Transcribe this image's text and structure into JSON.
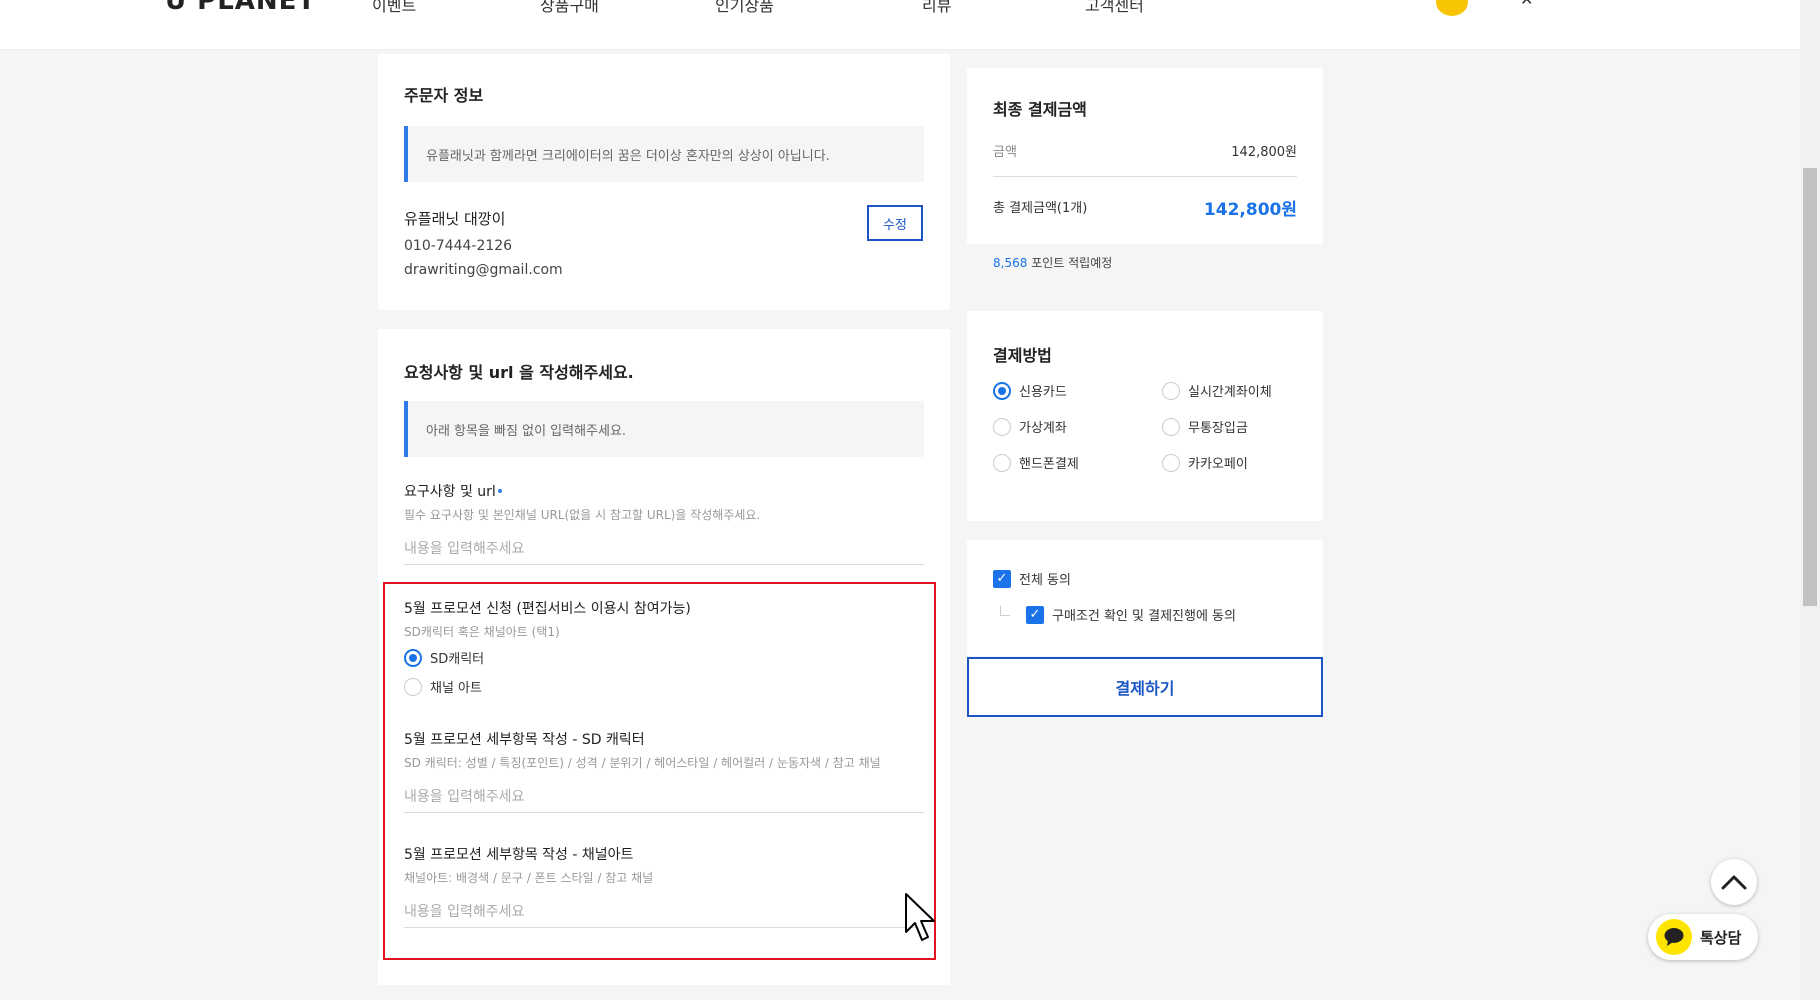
{
  "header": {
    "logo": "U PLANET",
    "nav": [
      "이벤트",
      "상품구매",
      "인기상품",
      "리뷰",
      "고객센터"
    ]
  },
  "orderer": {
    "title": "주문자 정보",
    "notice": "유플래닛과 함께라면 크리에이터의 꿈은 더이상 혼자만의 상상이 아닙니다.",
    "name": "유플래닛 대깡이",
    "phone": "010-7444-2126",
    "email": "drawriting@gmail.com",
    "edit_label": "수정"
  },
  "request": {
    "title": "요청사항 및 url 을 작성해주세요.",
    "notice": "아래 항목을 빠짐 없이 입력해주세요.",
    "field1": {
      "label": "요구사항 및 url",
      "required_mark": "•",
      "help": "필수 요구사항 및 본인채널 URL(없을 시 참고할 URL)을 작성해주세요.",
      "placeholder": "내용을 입력해주세요"
    },
    "promo": {
      "label": "5월 프로모션 신청 (편집서비스 이용시 참여가능)",
      "help": "SD캐릭터 혹은 채널아트 (택1)",
      "options": [
        "SD캐릭터",
        "채널 아트"
      ],
      "selected": "SD캐릭터"
    },
    "field2": {
      "label": "5월 프로모션 세부항목 작성 - SD 캐릭터",
      "help": "SD 캐릭터: 성별 / 특징(포인트) / 성격 / 분위기 / 헤어스타일 / 헤어컬러 / 눈동자색 / 참고 채널",
      "placeholder": "내용을 입력해주세요"
    },
    "field3": {
      "label": "5월 프로모션 세부항목 작성 - 채널아트",
      "help": "채널아트: 배경색 / 문구 / 폰트 스타일 / 참고 채널",
      "placeholder": "내용을 입력해주세요"
    }
  },
  "summary": {
    "title": "최종 결제금액",
    "amount_label": "금액",
    "amount_value": "142,800원",
    "total_label": "총 결제금액(1개)",
    "total_value": "142,800원",
    "points_value": "8,568",
    "points_text": "포인트 적립예정"
  },
  "payment": {
    "title": "결제방법",
    "methods": [
      "신용카드",
      "실시간계좌이체",
      "가상계좌",
      "무통장입금",
      "핸드폰결제",
      "카카오페이"
    ],
    "selected": "신용카드"
  },
  "agree": {
    "all_label": "전체 동의",
    "sub_label": "구매조건 확인 및 결제진행에 동의",
    "all_checked": true,
    "sub_checked": true
  },
  "pay_button": "결제하기",
  "floating": {
    "chat_label": "톡상담"
  },
  "colors": {
    "accent": "#1a73e8",
    "button_border": "#1a56c4",
    "highlight": "#e0141e",
    "kakao": "#fee500"
  }
}
